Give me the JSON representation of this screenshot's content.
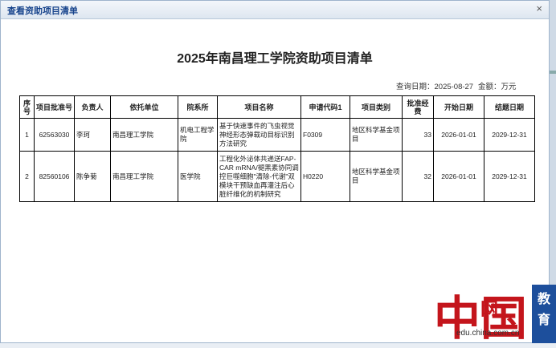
{
  "dialog": {
    "title": "查看资助项目清单",
    "close_icon": "close-icon"
  },
  "document": {
    "title": "2025年南昌理工学院资助项目清单",
    "query_date": "查询日期：2025-08-27",
    "amount_unit": "金额：万元"
  },
  "table": {
    "headers": [
      "序号",
      "项目批准号",
      "负责人",
      "依托单位",
      "院系所",
      "项目名称",
      "申请代码1",
      "项目类别",
      "批准经费",
      "开始日期",
      "结题日期"
    ],
    "rows": [
      [
        "1",
        "62563030",
        "李珂",
        "南昌理工学院",
        "机电工程学院",
        "基于快速事件的飞虫视觉神经形态弹载动目标识别方法研究",
        "F0309",
        "地区科学基金项目",
        "33",
        "2026-01-01",
        "2029-12-31"
      ],
      [
        "2",
        "82560106",
        "陈争菊",
        "南昌理工学院",
        "医学院",
        "工程化外泌体共递送FAP-CAR mRNA/褪黑素协同调控巨噬细胞\"清除-代谢\"双模块干预缺血再灌注后心脏纤维化的机制研究",
        "H0220",
        "地区科学基金项目",
        "32",
        "2026-01-01",
        "2029-12-31"
      ]
    ]
  },
  "watermark": {
    "logo_char": "中",
    "logo_char2": "国",
    "net": "网",
    "url": "edu.china.com.cn",
    "edu_label": "教育"
  }
}
